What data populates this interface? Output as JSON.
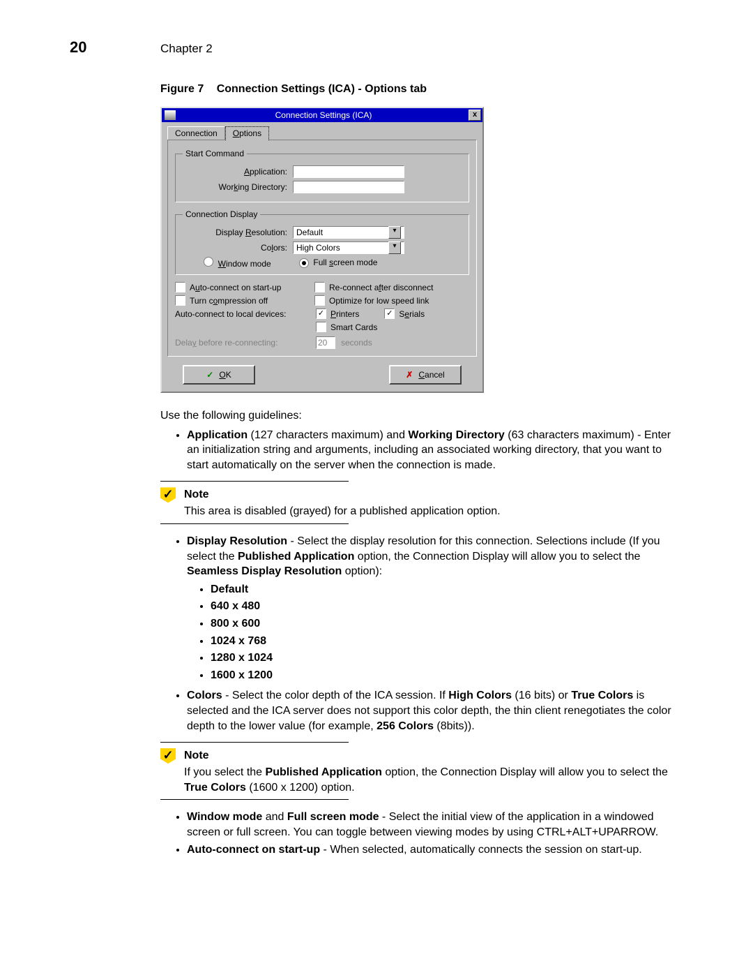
{
  "page": {
    "number": "20",
    "chapter": "Chapter 2"
  },
  "figure": {
    "label": "Figure 7",
    "title": "Connection Settings (ICA) - Options tab"
  },
  "dialog": {
    "title": "Connection Settings (ICA)",
    "tabs": {
      "connection": "Connection",
      "options_prefix": "O",
      "options_rest": "ptions"
    },
    "start_command": {
      "legend": "Start Command",
      "app_prefix": "A",
      "app_rest": "pplication:",
      "wd_prefix_a": "Wor",
      "wd_u": "k",
      "wd_rest": "ing Directory:"
    },
    "conn_display": {
      "legend": "Connection Display",
      "res_prefix": "Display ",
      "res_u": "R",
      "res_rest": "esolution:",
      "res_value": "Default",
      "colors_prefix": "Co",
      "colors_u": "l",
      "colors_rest": "ors:",
      "colors_value": "High Colors",
      "win_u": "W",
      "win_rest": "indow mode",
      "full_prefix": "Full ",
      "full_u": "s",
      "full_rest": "creen mode"
    },
    "checks": {
      "auto_start_prefix": "A",
      "auto_start_u": "u",
      "auto_start_rest": "to-connect on start-up",
      "reconn_prefix": "Re-connect a",
      "reconn_u": "f",
      "reconn_rest": "ter disconnect",
      "compress_prefix": "Turn c",
      "compress_u": "o",
      "compress_rest": "mpression off",
      "lowspeed": "Optimize for low speed link",
      "local_label": "Auto-connect to local devices:",
      "printers_u": "P",
      "printers_rest": "rinters",
      "serials_prefix": "S",
      "serials_u": "e",
      "serials_rest": "rials",
      "smart": "Smart Cards"
    },
    "delay": {
      "label_prefix": "Dela",
      "label_u": "y",
      "label_rest": " before re-connecting:",
      "value": "20",
      "unit": "seconds"
    },
    "buttons": {
      "ok_u": "O",
      "ok_rest": "K",
      "cancel_u": "C",
      "cancel_rest": "ancel"
    }
  },
  "body": {
    "intro": "Use the following guidelines:",
    "b1_bold1": "Application",
    "b1_mid1": " (127 characters maximum) and ",
    "b1_bold2": "Working Directory",
    "b1_rest": " (63 characters maximum) - Enter an initialization string and arguments, including an associated working directory, that you want to start automatically on the server when the connection is made.",
    "note1_title": "Note",
    "note1_body": "This area is disabled (grayed) for a published application option.",
    "b2_bold": "Display Resolution",
    "b2_mid1": " - Select the display resolution for this connection. Selections include (If you select the ",
    "b2_bold2": "Published Application",
    "b2_mid2": " option, the Connection Display will allow you to select the ",
    "b2_bold3": "Seamless Display Resolution",
    "b2_rest": " option):",
    "res_list": [
      "Default",
      "640 x 480",
      "800 x 600",
      "1024 x 768",
      "1280 x 1024",
      "1600 x 1200"
    ],
    "b3_bold": "Colors",
    "b3_mid1": " - Select the color depth of the ICA session. If ",
    "b3_bold2": "High Colors",
    "b3_mid2": " (16 bits) or ",
    "b3_bold3": "True Colors",
    "b3_mid3": " is selected and the ICA server does not support this color depth, the thin client renegotiates the color depth to the lower value (for example, ",
    "b3_bold4": "256 Colors",
    "b3_rest": " (8bits)).",
    "note2_title": "Note",
    "note2_a": "If you select the ",
    "note2_bold1": "Published Application",
    "note2_b": " option, the Connection Display will allow you to select the ",
    "note2_bold2": "True Colors",
    "note2_c": " (1600 x 1200) option.",
    "b4_bold1": "Window mode",
    "b4_mid": " and ",
    "b4_bold2": "Full screen mode",
    "b4_rest": " - Select the initial view of the application in a windowed screen or full screen. You can toggle between viewing modes by using CTRL+ALT+UPARROW.",
    "b5_bold": "Auto-connect on start-up",
    "b5_rest": " - When selected, automatically connects the session on start-up."
  }
}
